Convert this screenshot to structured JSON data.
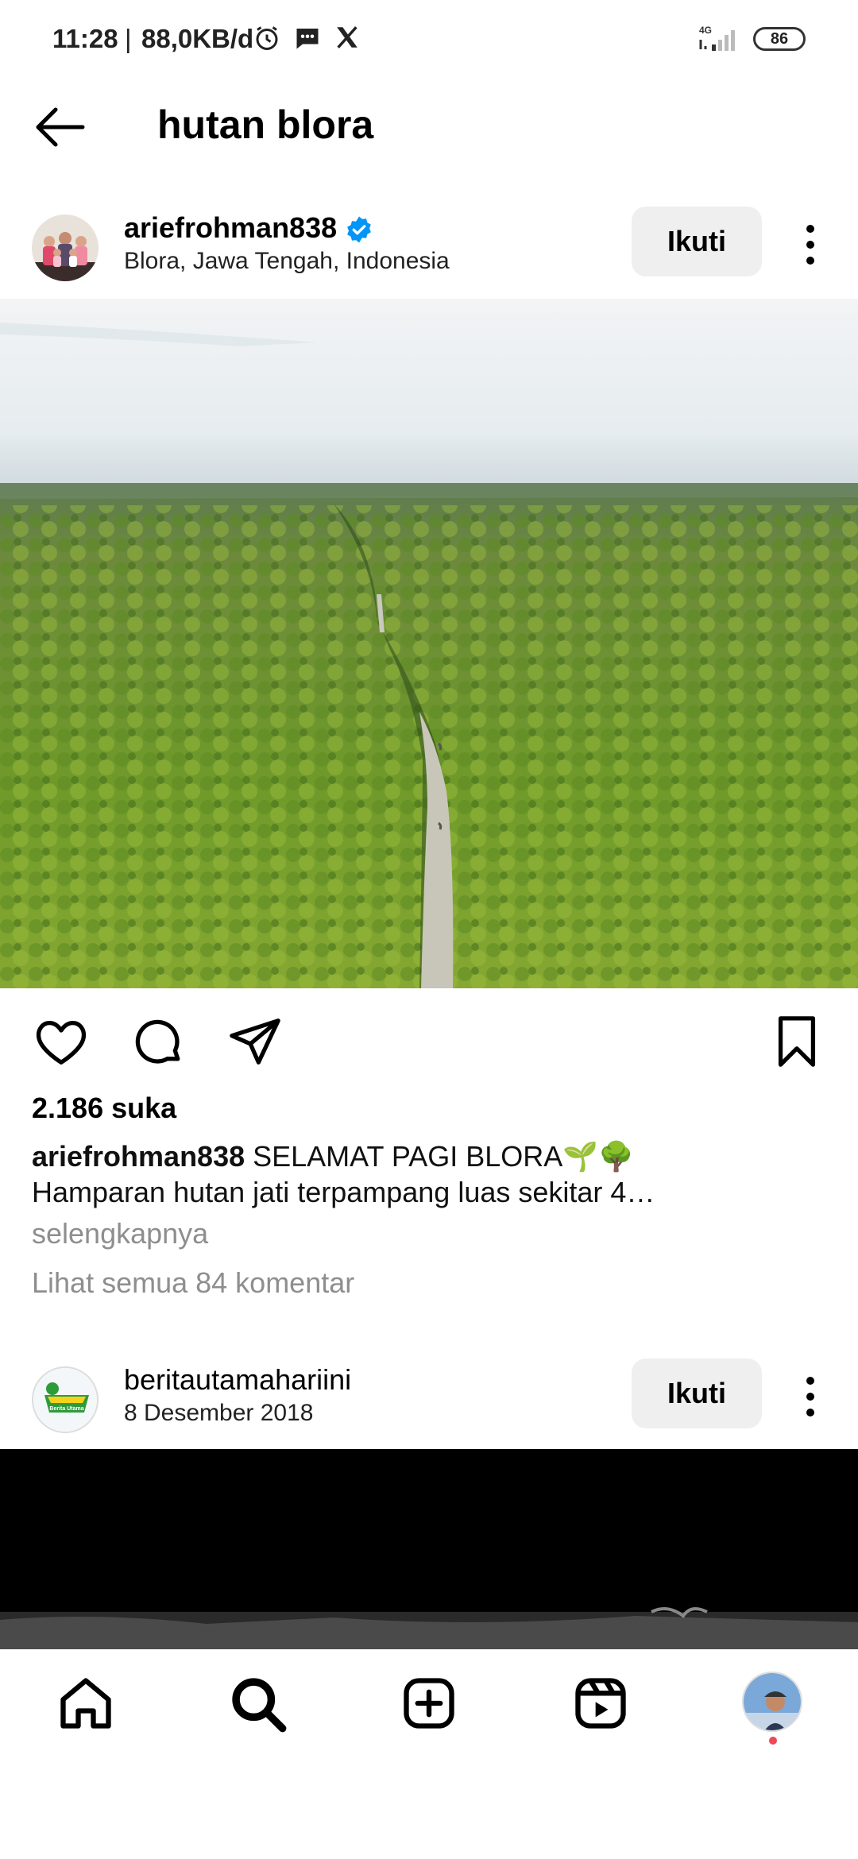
{
  "status_bar": {
    "time": "11:28",
    "separator": "|",
    "speed": "88,0KB/d",
    "network_label": "4G",
    "battery": "86"
  },
  "header": {
    "title": "hutan blora"
  },
  "post1": {
    "username": "ariefrohman838",
    "location": "Blora, Jawa Tengah, Indonesia",
    "follow_label": "Ikuti",
    "likes": "2.186 suka",
    "caption_user": "ariefrohman838",
    "caption_text": " SELAMAT PAGI BLORA🌱🌳",
    "caption_line2": "Hamparan hutan jati terpampang luas sekitar 4…",
    "more_label": "selengkapnya",
    "comments_label": "Lihat semua 84 komentar"
  },
  "post2": {
    "username": "beritautamahariini",
    "date": "8 Desember 2018",
    "follow_label": "Ikuti",
    "avatar_text": "Berita Utama"
  },
  "colors": {
    "verified": "#0095f6",
    "follow_bg": "#efefef",
    "muted": "#8e8e8e",
    "notification_dot": "#ed4956"
  },
  "nav": {
    "items": [
      "home-icon",
      "search-icon",
      "create-icon",
      "reels-icon",
      "profile-avatar"
    ]
  }
}
